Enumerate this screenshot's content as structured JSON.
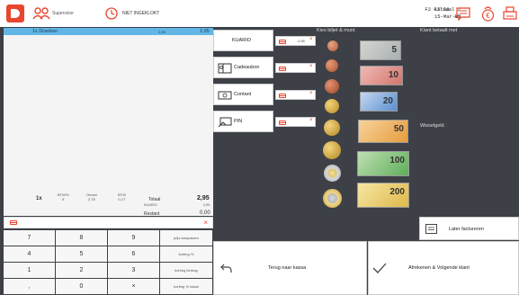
{
  "topbar": {
    "user_label": "Supervisor",
    "clock_label": "NIET INGEKLOKT",
    "info_left_1": "F2 Filiaal 2",
    "info_left_2": "Rb",
    "info_right_1": "13:03",
    "info_right_2": "15-Mar-22"
  },
  "order": {
    "item": "1x Dranken",
    "price": "2,95",
    "total": "2,95"
  },
  "summary": {
    "qty": "1x",
    "vat": [
      {
        "label": "BTW%",
        "value": "6"
      },
      {
        "label": "Omzet",
        "value": "2,78"
      },
      {
        "label": "BTW",
        "value": "0,17"
      }
    ],
    "total_label": "Totaal",
    "total": "2,95",
    "sub_label": "KUARIO",
    "sub_value": "2,95",
    "rest_label": "Restant",
    "rest_value": "0,00"
  },
  "keypad": {
    "keys": [
      "7",
      "8",
      "9",
      "prijs aanpassen",
      "4",
      "5",
      "6",
      "korting %",
      "1",
      "2",
      "3",
      "korting bedrag",
      ",",
      "0",
      "×",
      "korting % totaal"
    ]
  },
  "payment_methods": [
    {
      "label": "KUARIO",
      "value": "2,95"
    },
    {
      "label": "Cadeaubon",
      "value": ""
    },
    {
      "label": "Contant",
      "value": ""
    },
    {
      "label": "PIN",
      "value": ""
    }
  ],
  "sections": {
    "kies": "Kies biljet & munt",
    "klant": "Klant betaalt met",
    "wisselgeld": "Wisselgeld"
  },
  "notes": [
    "5",
    "10",
    "20",
    "50",
    "100",
    "200"
  ],
  "buttons": {
    "later": "Later factureren",
    "back": "Terug naar kassa",
    "finish": "Afrekenen & Volgende klant"
  },
  "colors": {
    "accent": "#e8462d",
    "selected_row": "#62b6e5",
    "background": "#3d4147"
  }
}
